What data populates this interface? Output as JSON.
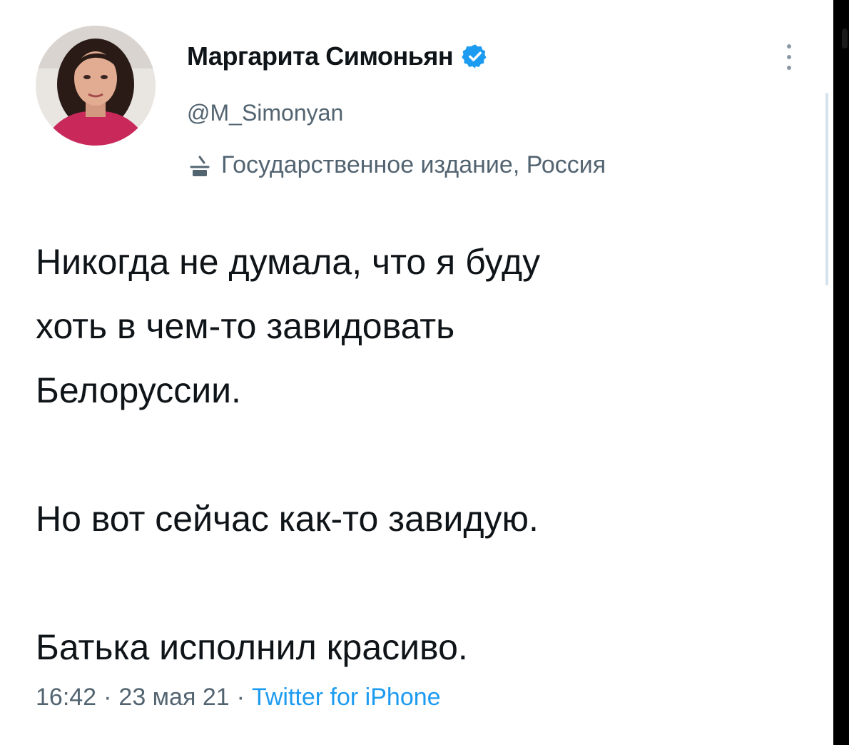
{
  "author": {
    "display_name": "Маргарита Симоньян",
    "handle": "@M_Simonyan",
    "label": "Государственное издание, Россия",
    "verified": true,
    "avatar_icon": "profile-photo"
  },
  "tweet": {
    "paragraphs": [
      "Никогда не думала, что я буду",
      "хоть в чем-то завидовать",
      "Белоруссии.",
      "Но вот сейчас как-то завидую.",
      "Батька исполнил красиво."
    ]
  },
  "meta": {
    "time": "16:42",
    "separator": "·",
    "date": "23 мая 21",
    "source": "Twitter for iPhone"
  },
  "colors": {
    "text_primary": "#0f1419",
    "text_secondary": "#536471",
    "accent": "#1d9bf0",
    "background": "#ffffff"
  }
}
